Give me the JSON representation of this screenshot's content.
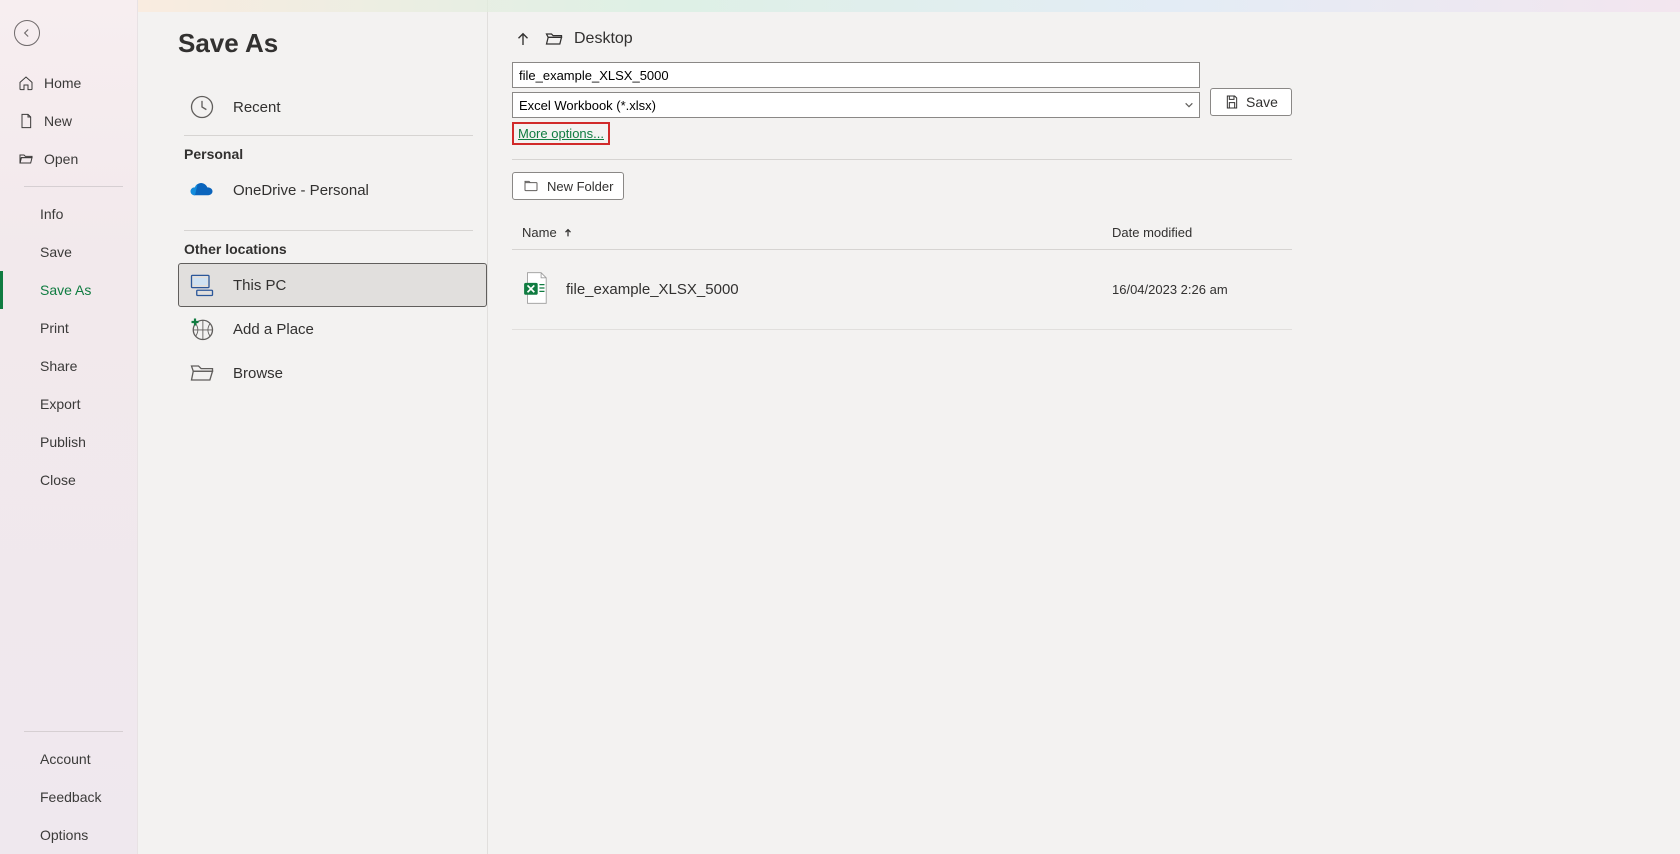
{
  "sidebar": {
    "home": "Home",
    "new": "New",
    "open": "Open",
    "info": "Info",
    "save": "Save",
    "save_as": "Save As",
    "print": "Print",
    "share": "Share",
    "export": "Export",
    "publish": "Publish",
    "close": "Close",
    "account": "Account",
    "feedback": "Feedback",
    "options": "Options"
  },
  "page": {
    "title": "Save As"
  },
  "locations": {
    "recent": "Recent",
    "personal_label": "Personal",
    "onedrive": "OneDrive - Personal",
    "other_label": "Other locations",
    "this_pc": "This PC",
    "add_place": "Add a Place",
    "browse": "Browse"
  },
  "content": {
    "breadcrumb": "Desktop",
    "filename": "file_example_XLSX_5000",
    "filetype": "Excel Workbook (*.xlsx)",
    "more_options": "More options...",
    "save_label": "Save",
    "new_folder": "New Folder",
    "columns": {
      "name": "Name",
      "date": "Date modified"
    },
    "files": [
      {
        "name": "file_example_XLSX_5000",
        "date": "16/04/2023 2:26 am"
      }
    ]
  }
}
